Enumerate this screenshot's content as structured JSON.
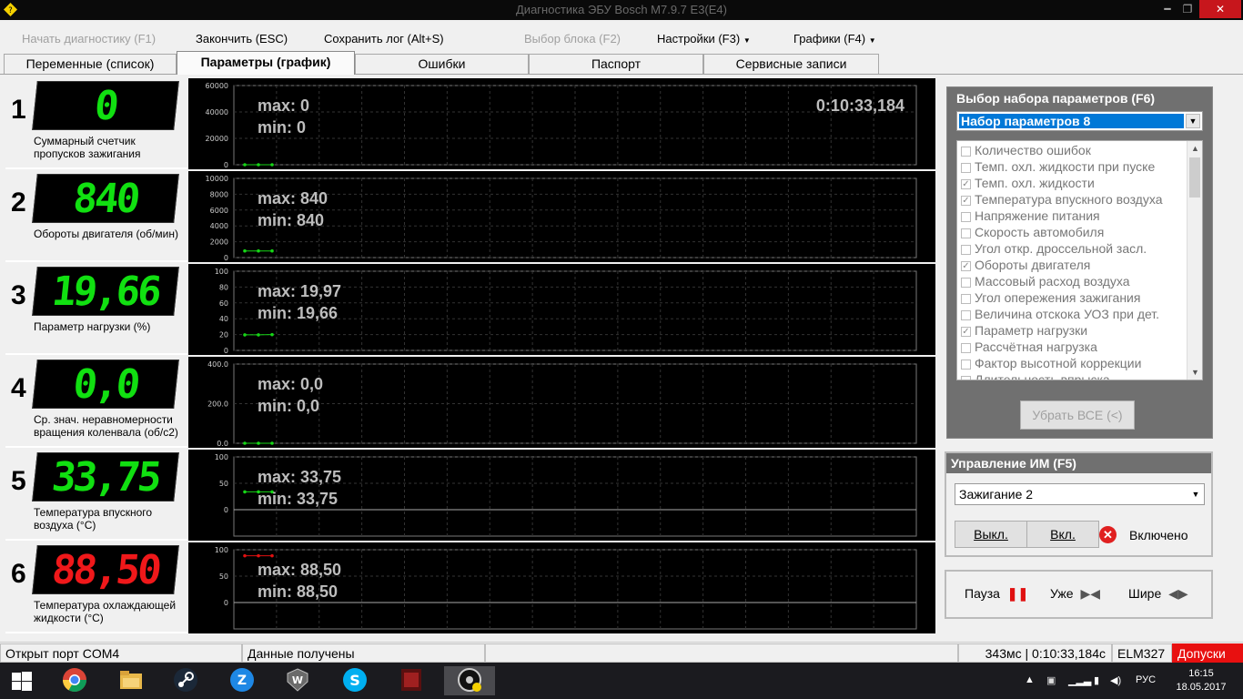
{
  "window": {
    "title": "Диагностика ЭБУ Bosch M7.9.7 E3(E4)",
    "min_glyph": "━",
    "max_glyph": "❐",
    "close_glyph": "✕"
  },
  "menu": {
    "start_diag": "Начать диагностику (F1)",
    "finish": "Закончить (ESC)",
    "save_log": "Сохранить лог (Alt+S)",
    "select_block": "Выбор блока (F2)",
    "settings": "Настройки (F3)",
    "graphs": "Графики (F4)"
  },
  "tabs": [
    "Переменные (список)",
    "Параметры (график)",
    "Ошибки",
    "Паспорт",
    "Сервисные записи"
  ],
  "active_tab": 1,
  "params": [
    {
      "num": "1",
      "value": "0",
      "color": "green",
      "label": "Суммарный счетчик пропусков зажигания",
      "max": "max: 0",
      "min": "min: 0",
      "time": "0:10:33,184",
      "yticks": [
        "60000",
        "40000",
        "20000",
        "0"
      ],
      "yvalues": [
        60000,
        40000,
        20000,
        0
      ],
      "ymax": 60000,
      "series": [
        0,
        0,
        0
      ],
      "line_color": "#16d616"
    },
    {
      "num": "2",
      "value": "840",
      "color": "green",
      "label": "Обороты двигателя (об/мин)",
      "max": "max: 840",
      "min": "min: 840",
      "time": "",
      "yticks": [
        "10000",
        "8000",
        "6000",
        "4000",
        "2000",
        "0"
      ],
      "yvalues": [
        10000,
        8000,
        6000,
        4000,
        2000,
        0
      ],
      "ymax": 10000,
      "series": [
        840,
        840,
        840
      ],
      "line_color": "#16d616"
    },
    {
      "num": "3",
      "value": "19,66",
      "color": "green",
      "label": "Параметр нагрузки (%)",
      "max": "max: 19,97",
      "min": "min: 19,66",
      "time": "",
      "yticks": [
        "100",
        "80",
        "60",
        "40",
        "20",
        "0"
      ],
      "yvalues": [
        100,
        80,
        60,
        40,
        20,
        0
      ],
      "ymax": 100,
      "series": [
        19.66,
        19.66,
        19.97
      ],
      "line_color": "#16d616"
    },
    {
      "num": "4",
      "value": "0,0",
      "color": "green",
      "label": "Ср. знач. неравномерности вращения коленвала (об/с2)",
      "max": "max: 0,0",
      "min": "min: 0,0",
      "time": "",
      "yticks": [
        "400.0",
        "200.0",
        "0.0"
      ],
      "yvalues": [
        400,
        200,
        0
      ],
      "ymax": 400,
      "series": [
        0,
        0,
        0
      ],
      "line_color": "#16d616"
    },
    {
      "num": "5",
      "value": "33,75",
      "color": "green",
      "label": "Температура впускного воздуха (°С)",
      "max": "max: 33,75",
      "min": "min: 33,75",
      "time": "",
      "yticks": [
        "100",
        "50",
        "0"
      ],
      "yvalues": [
        100,
        50,
        0
      ],
      "ymax": 100,
      "ymin": -50,
      "series": [
        33.75,
        33.75,
        33.75
      ],
      "line_color": "#16d616"
    },
    {
      "num": "6",
      "value": "88,50",
      "color": "red",
      "label": "Температура охлаждающей жидкости (°С)",
      "max": "max: 88,50",
      "min": "min: 88,50",
      "time": "",
      "yticks": [
        "100",
        "50",
        "0"
      ],
      "yvalues": [
        100,
        50,
        0
      ],
      "ymax": 100,
      "ymin": -50,
      "series": [
        88.5,
        88.5,
        88.5
      ],
      "line_color": "#e01010"
    }
  ],
  "param_set": {
    "header": "Выбор набора параметров (F6)",
    "selected": "Набор параметров 8",
    "items": [
      {
        "label": "Количество ошибок",
        "checked": false
      },
      {
        "label": "Темп. охл. жидкости при пуске",
        "checked": false
      },
      {
        "label": "Темп. охл. жидкости",
        "checked": true
      },
      {
        "label": "Температура впускного воздуха",
        "checked": true
      },
      {
        "label": "Напряжение питания",
        "checked": false
      },
      {
        "label": "Скорость автомобиля",
        "checked": false
      },
      {
        "label": "Угол откр. дроссельной засл.",
        "checked": false
      },
      {
        "label": "Обороты двигателя",
        "checked": true
      },
      {
        "label": "Массовый расход воздуха",
        "checked": false
      },
      {
        "label": "Угол опережения зажигания",
        "checked": false
      },
      {
        "label": "Величина отскока УОЗ при дет.",
        "checked": false
      },
      {
        "label": "Параметр нагрузки",
        "checked": true
      },
      {
        "label": "Рассчётная нагрузка",
        "checked": false
      },
      {
        "label": "Фактор высотной коррекции",
        "checked": false
      },
      {
        "label": "Длительность впрыска",
        "checked": false
      }
    ],
    "clear_all": "Убрать ВСЕ (<)"
  },
  "im_control": {
    "header": "Управление ИМ (F5)",
    "selected": "Зажигание 2",
    "off_label": "Выкл.",
    "on_label": "Вкл.",
    "status": "Включено"
  },
  "playback": {
    "pause": "Пауза",
    "narrower": "Уже",
    "wider": "Шире"
  },
  "status": {
    "port": "Открыт порт COM4",
    "data": "Данные получены",
    "empty": "",
    "timing": "343мс | 0:10:33,184с",
    "adapter": "ELM327",
    "tolerances": "Допуски"
  },
  "taskbar": {
    "lang": "РУС",
    "time": "16:15",
    "date": "18.05.2017"
  }
}
